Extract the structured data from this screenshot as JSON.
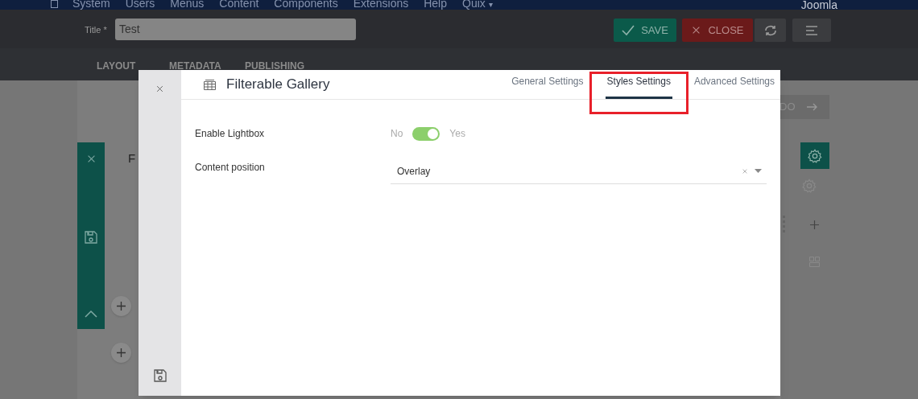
{
  "top_menu": {
    "items": [
      "System",
      "Users",
      "Menus",
      "Content",
      "Components",
      "Extensions",
      "Help",
      "Quix"
    ],
    "dropdown_mark": "▾",
    "right": "Joomla"
  },
  "toolbar": {
    "title_label": "Title *",
    "title_value": "Test",
    "buttons": [
      {
        "kind": "save",
        "label": "SAVE"
      },
      {
        "kind": "close",
        "label": "CLOSE"
      },
      {
        "kind": "refresh"
      },
      {
        "kind": "menu"
      }
    ]
  },
  "page_tabs": [
    "LAYOUT",
    "METADATA",
    "PUBLISHING"
  ],
  "builder": {
    "redo_label": "DO",
    "element_label": "F"
  },
  "modal": {
    "title": "Filterable Gallery",
    "tabs": [
      {
        "label": "General Settings",
        "selected": false,
        "highlighted": false
      },
      {
        "label": "Styles Settings",
        "selected": true,
        "highlighted": true
      },
      {
        "label": "Advanced Settings",
        "selected": false,
        "highlighted": false
      }
    ],
    "fields": [
      {
        "kind": "toggle",
        "label": "Enable Lightbox",
        "off_label": "No",
        "on_label": "Yes",
        "on": true
      },
      {
        "kind": "select",
        "label": "Content position",
        "value": "Overlay"
      }
    ]
  }
}
